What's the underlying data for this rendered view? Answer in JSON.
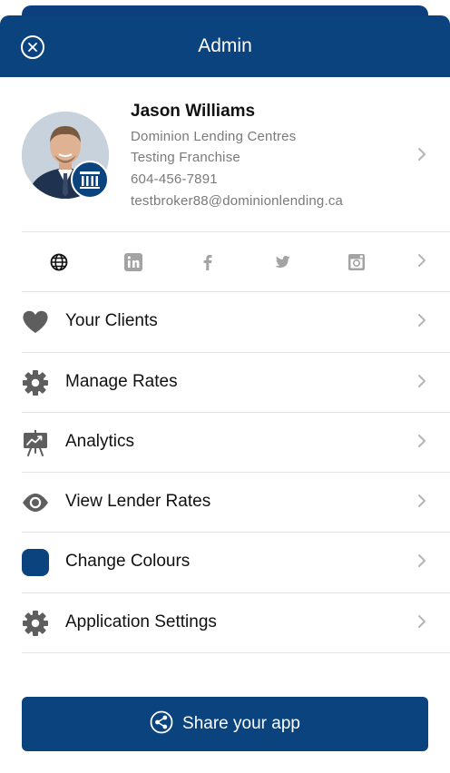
{
  "header": {
    "title": "Admin"
  },
  "profile": {
    "name": "Jason Williams",
    "company": "Dominion Lending Centres",
    "franchise": "Testing Franchise",
    "phone": "604-456-7891",
    "email": "testbroker88@dominionlending.ca"
  },
  "social": [
    "website-icon",
    "linkedin-icon",
    "facebook-icon",
    "twitter-icon",
    "instagram-icon"
  ],
  "menu": [
    {
      "label": "Your Clients",
      "icon": "heart-icon"
    },
    {
      "label": "Manage Rates",
      "icon": "gear-icon"
    },
    {
      "label": "Analytics",
      "icon": "presentation-chart-icon"
    },
    {
      "label": "View Lender Rates",
      "icon": "eye-icon"
    },
    {
      "label": "Change Colours",
      "icon": "color-swatch"
    },
    {
      "label": "Application Settings",
      "icon": "gear-icon"
    }
  ],
  "share": {
    "label": "Share your app"
  },
  "colors": {
    "brand": "#0b437f",
    "icon_gray": "#5e5e5e",
    "muted_text": "#7a7a7a"
  }
}
